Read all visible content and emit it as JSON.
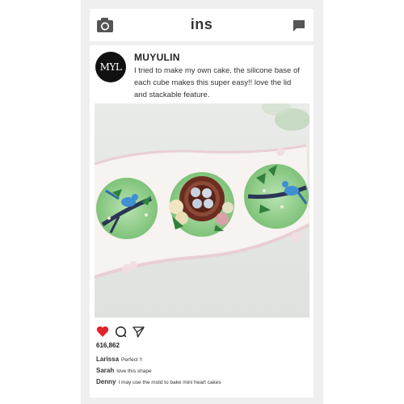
{
  "app": {
    "title": "ins",
    "camera_icon": "camera-icon",
    "message_icon": "message-icon"
  },
  "post": {
    "avatar_text": "MYL",
    "username": "MUYULIN",
    "caption": "I tried to make my own cake. the silicone base of each cube makes this super easy!! love the lid and stackable feature.",
    "likes": "616,862",
    "liked": true,
    "heart_color": "#e0242d",
    "comments": [
      {
        "user": "Larissa",
        "text": "Perfect !!"
      },
      {
        "user": "Sarah",
        "text": "love this shape"
      },
      {
        "user": "Denny",
        "text": "I may use the mold to bake mini heart cakes"
      }
    ]
  }
}
